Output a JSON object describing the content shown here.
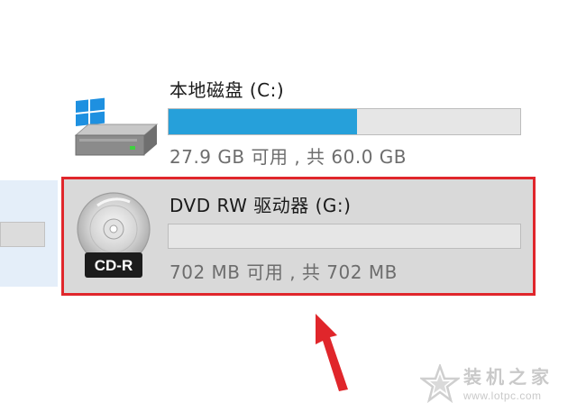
{
  "drives": {
    "c": {
      "name": "本地磁盘 (C:)",
      "info": "27.9 GB 可用 , 共 60.0 GB",
      "used_fraction": 0.535,
      "icon": "windows-hard-drive-icon"
    },
    "g": {
      "name": "DVD RW 驱动器 (G:)",
      "info": "702 MB 可用 , 共 702 MB",
      "used_fraction": 0.0,
      "icon": "cd-r-disc-icon",
      "icon_label": "CD-R"
    }
  },
  "annotation": {
    "highlight_color": "#e0262b",
    "arrow_color": "#e0262b"
  },
  "watermark": {
    "title": "装机之家",
    "url": "www.lotpc.com",
    "icon": "star-logo-icon"
  },
  "colors": {
    "accent": "#26a0da",
    "selection_background": "#d9d9d9"
  }
}
